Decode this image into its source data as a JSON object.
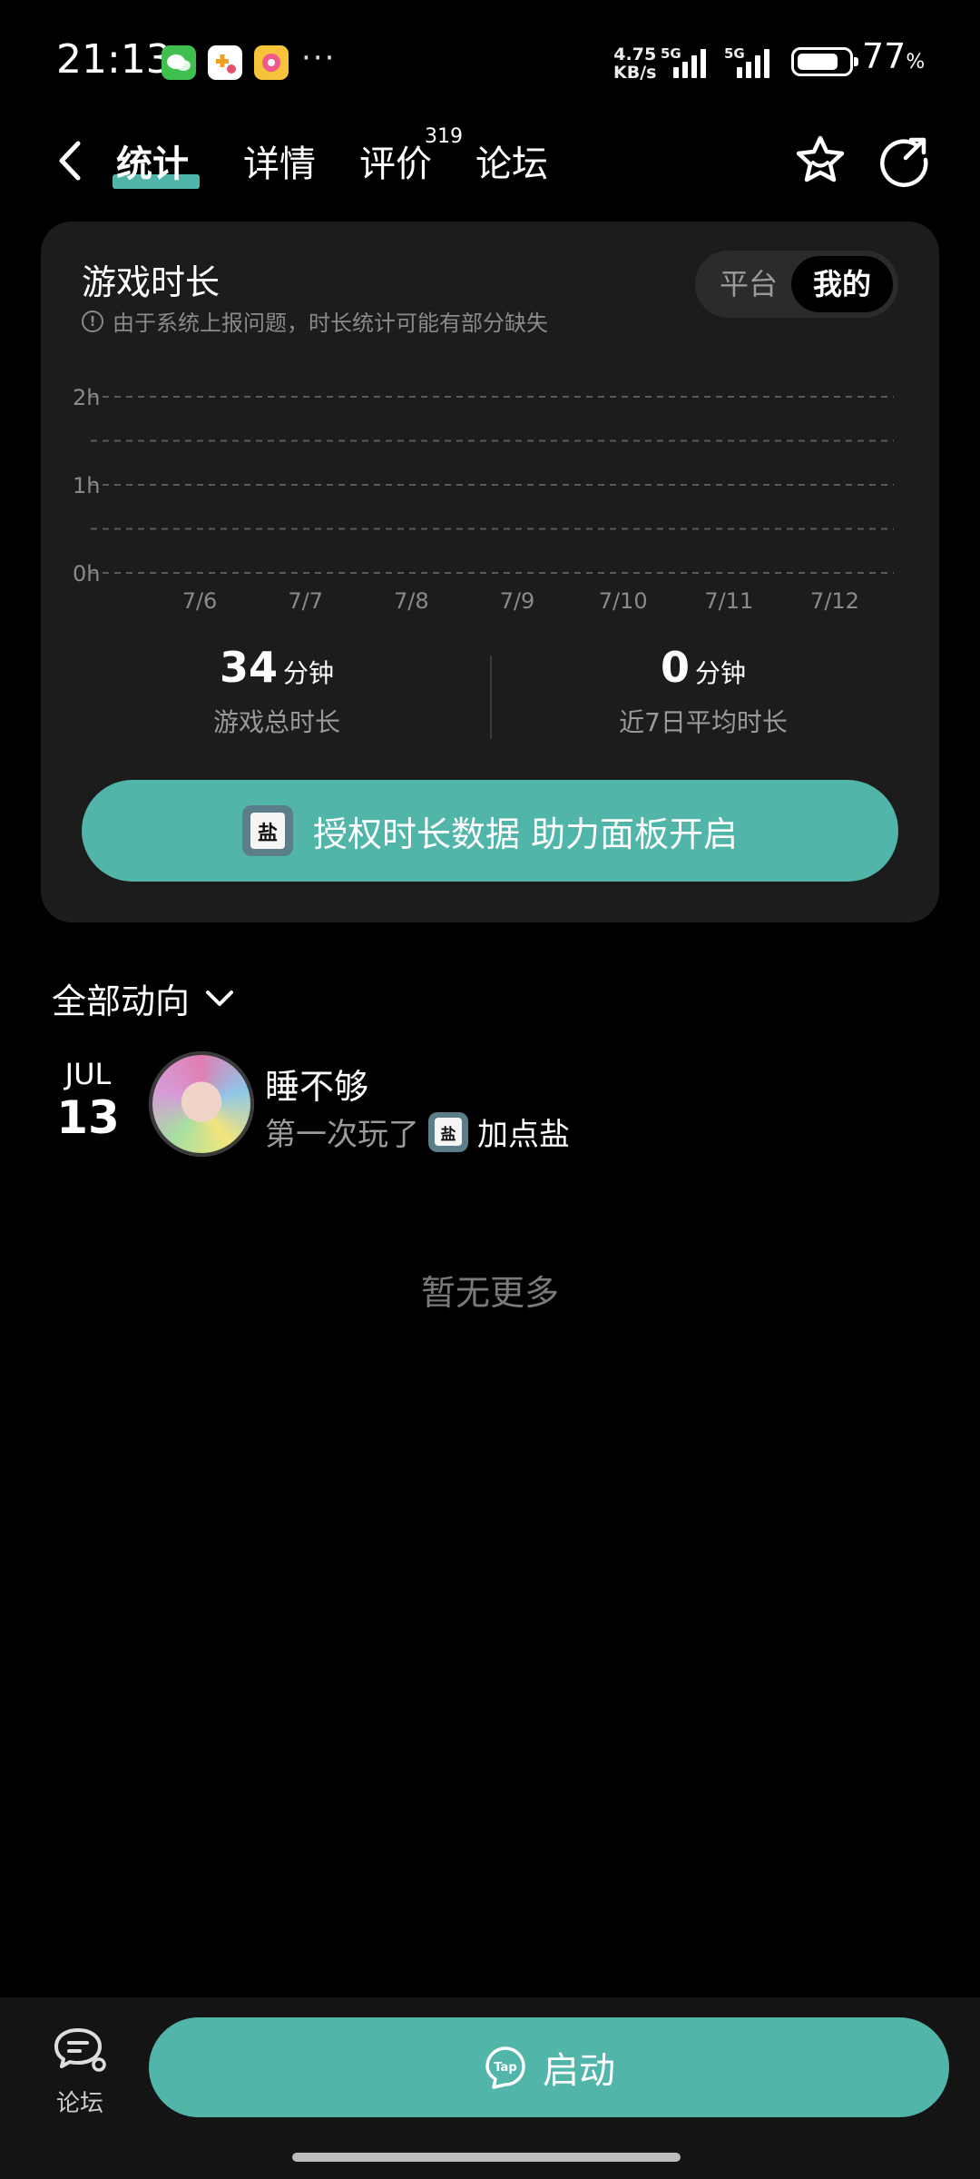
{
  "status_bar": {
    "time": "21:13",
    "net_speed_value": "4.75",
    "net_speed_unit": "KB/s",
    "signal1_label": "5G",
    "signal2_label": "5G",
    "battery_percent": "77",
    "battery_percent_symbol": "%",
    "battery_level": 0.77
  },
  "nav": {
    "tabs": [
      {
        "label": "统计"
      },
      {
        "label": "详情"
      },
      {
        "label": "评价"
      },
      {
        "label": "论坛"
      }
    ],
    "review_count": "319"
  },
  "playtime_card": {
    "title": "游戏时长",
    "note": "由于系统上报问题，时长统计可能有部分缺失",
    "toggle_options": [
      "平台",
      "我的"
    ],
    "selected_toggle": "我的",
    "total": {
      "value": "34",
      "unit": "分钟",
      "label": "游戏总时长"
    },
    "average": {
      "value": "0",
      "unit": "分钟",
      "label": "近7日平均时长"
    },
    "auth_button_label": "授权时长数据 助力面板开启"
  },
  "chart_data": {
    "type": "bar",
    "categories": [
      "7/6",
      "7/7",
      "7/8",
      "7/9",
      "7/10",
      "7/11",
      "7/12"
    ],
    "values": [
      0,
      0,
      0,
      0,
      0,
      0,
      0
    ],
    "y_ticks": [
      "0h",
      "1h",
      "2h"
    ],
    "ylim": [
      0,
      2
    ],
    "grid": true,
    "title": "",
    "xlabel": "",
    "ylabel": ""
  },
  "feed": {
    "filter_label": "全部动向",
    "items": [
      {
        "month": "JUL",
        "day": "13",
        "user_name": "睡不够",
        "action": "第一次玩了",
        "game_name": "加点盐"
      }
    ],
    "empty_text": "暂无更多"
  },
  "bottom_bar": {
    "forum_label": "论坛",
    "launch_label": "启动",
    "tap_logo_text": "Tap"
  },
  "colors": {
    "accent": "#51b5a9",
    "card_bg": "#1c1c1c",
    "page_bg": "#000000"
  }
}
